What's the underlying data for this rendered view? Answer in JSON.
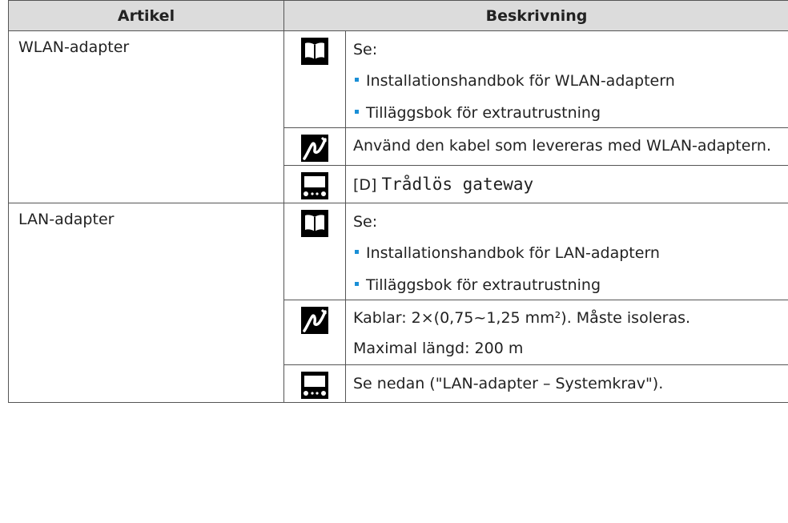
{
  "header": {
    "col1": "Artikel",
    "col2": "Beskrivning"
  },
  "rows": [
    {
      "artikel": "WLAN-adapter",
      "book": {
        "se": "Se:",
        "bullets": [
          "Installationshandbok för WLAN-adaptern",
          "Tilläggsbok för extrautrustning"
        ]
      },
      "cable": {
        "text": "Använd den kabel som levereras med WLAN-adaptern."
      },
      "settings": {
        "prefix": "[D]",
        "code": "Trådlös gateway"
      }
    },
    {
      "artikel": "LAN-adapter",
      "book": {
        "se": "Se:",
        "bullets": [
          "Installationshandbok för LAN-adaptern",
          "Tilläggsbok för extrautrustning"
        ]
      },
      "cable": {
        "line1": "Kablar: 2×(0,75~1,25 mm²). Måste isoleras.",
        "line2": "Maximal längd: 200 m"
      },
      "settings": {
        "text": "Se nedan (\"LAN-adapter – Systemkrav\")."
      }
    }
  ],
  "icons": [
    "book-icon",
    "cable-icon",
    "controller-icon"
  ]
}
